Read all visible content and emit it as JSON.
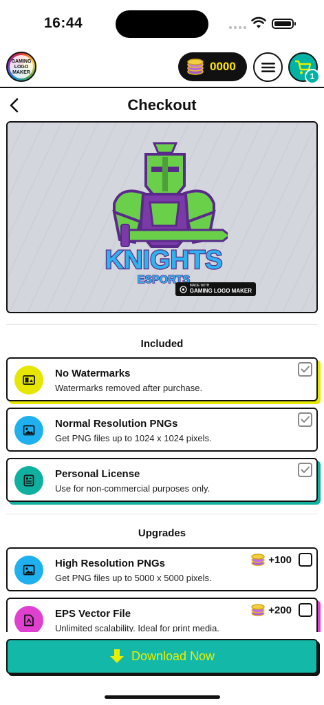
{
  "status_bar": {
    "time": "16:44"
  },
  "app_logo": {
    "line1": "GAMING",
    "line2": "LOGO",
    "line3": "MAKER"
  },
  "header": {
    "coins": "0000",
    "cart_count": "1"
  },
  "page": {
    "title": "Checkout"
  },
  "preview": {
    "logo_text": "KNIGHTS",
    "logo_subtext": "ESPORTS",
    "watermark_small": "MADE WITH",
    "watermark_big": "GAMING LOGO MAKER"
  },
  "included": {
    "title": "Included",
    "items": [
      {
        "title": "No Watermarks",
        "description": "Watermarks removed after purchase.",
        "icon": "watermark-icon",
        "color": "#e6e600"
      },
      {
        "title": "Normal Resolution PNGs",
        "description": "Get PNG files up to 1024 x 1024 pixels.",
        "icon": "image-icon",
        "color": "#1fb0f0"
      },
      {
        "title": "Personal License",
        "description": "Use for non-commercial purposes only.",
        "icon": "license-icon",
        "color": "#10b0a0"
      }
    ]
  },
  "upgrades": {
    "title": "Upgrades",
    "items": [
      {
        "title": "High Resolution PNGs",
        "description": "Get PNG files up to 5000 x 5000 pixels.",
        "price": "+100",
        "icon": "image-icon",
        "color": "#1fb0f0"
      },
      {
        "title": "EPS Vector File",
        "description": "Unlimited scalability. Ideal for print media.",
        "price": "+200",
        "icon": "vector-file-icon",
        "color": "#e040d0"
      }
    ]
  },
  "download": {
    "label": "Download Now"
  },
  "colors": {
    "teal": "#14b8a8",
    "yellow": "#e8f000",
    "magenta": "#e040d0",
    "blue": "#1fb0f0"
  }
}
